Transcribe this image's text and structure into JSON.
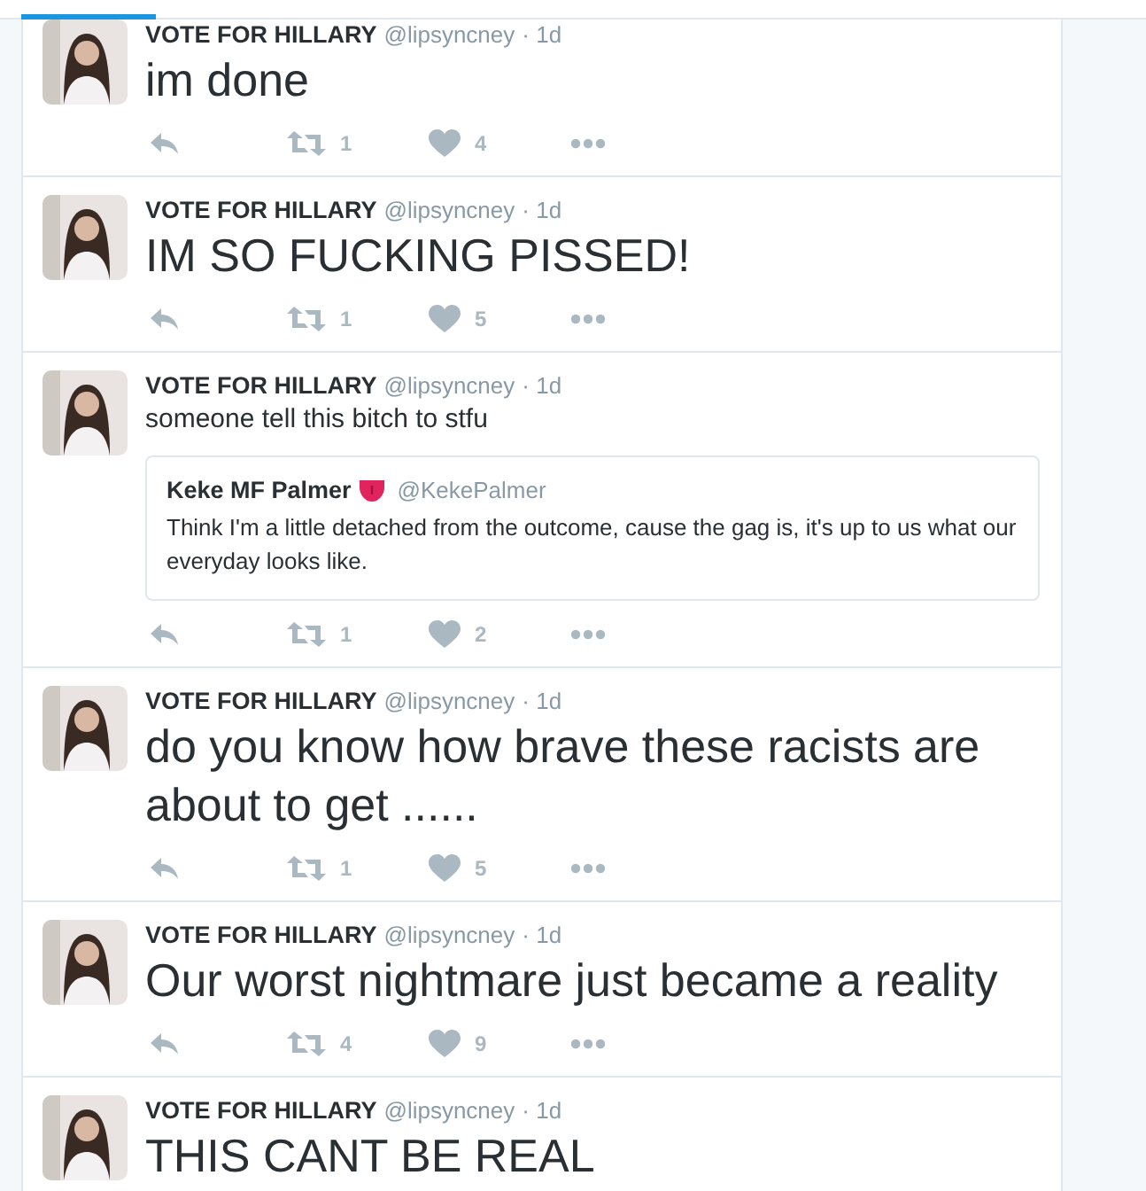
{
  "tweets": [
    {
      "author": "VOTE FOR HILLARY",
      "handle": "@lipsyncney",
      "time": "· 1d",
      "text": "im done",
      "kind": "large",
      "retweets": "1",
      "likes": "4"
    },
    {
      "author": "VOTE FOR HILLARY",
      "handle": "@lipsyncney",
      "time": "· 1d",
      "text": "IM SO FUCKING PISSED!",
      "kind": "large",
      "retweets": "1",
      "likes": "5"
    },
    {
      "author": "VOTE FOR HILLARY",
      "handle": "@lipsyncney",
      "time": "· 1d",
      "text": "someone tell this bitch to stfu",
      "kind": "normal",
      "quote": {
        "author": "Keke MF Palmer",
        "handle": "@KekePalmer",
        "text": "Think I'm a little detached from the outcome, cause the gag is, it's up to us what our everyday looks like."
      },
      "retweets": "1",
      "likes": "2"
    },
    {
      "author": "VOTE FOR HILLARY",
      "handle": "@lipsyncney",
      "time": "· 1d",
      "text": "do you know how brave these racists are about to get ......",
      "kind": "large",
      "retweets": "1",
      "likes": "5"
    },
    {
      "author": "VOTE FOR HILLARY",
      "handle": "@lipsyncney",
      "time": "· 1d",
      "text": "Our worst nightmare just became a reality",
      "kind": "large",
      "retweets": "4",
      "likes": "9"
    },
    {
      "author": "VOTE FOR HILLARY",
      "handle": "@lipsyncney",
      "time": "· 1d",
      "text": "THIS CANT BE REAL",
      "kind": "large"
    }
  ]
}
